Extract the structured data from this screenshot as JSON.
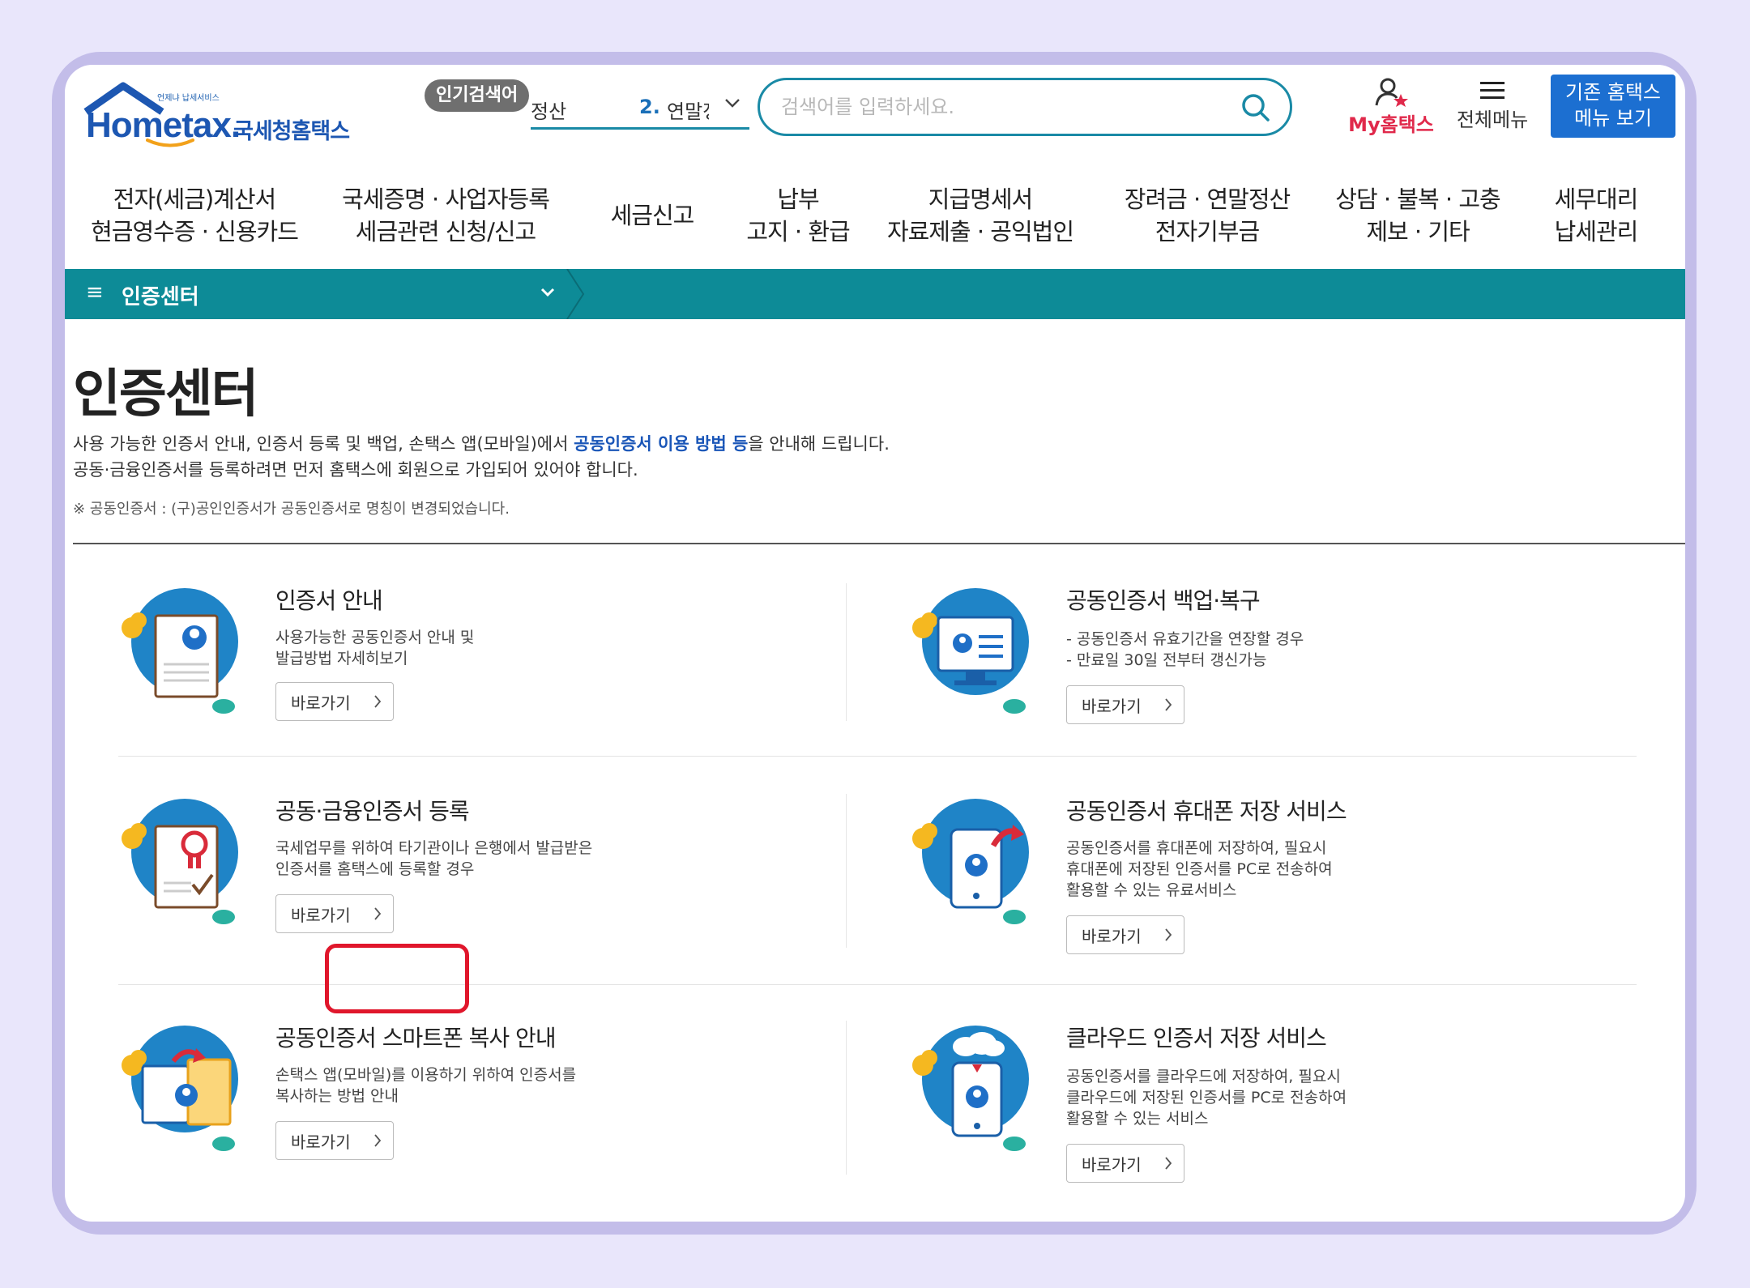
{
  "brand": {
    "logo_sub": "언제냐 납세서비스",
    "logo_name": "Hometax.",
    "logo_kr": "국세청홈택스"
  },
  "header": {
    "popular_label": "인기검색어",
    "popular_prev": "정산",
    "popular_rank": "2.",
    "popular_item": "연말정산",
    "search_placeholder": "검색어를 입력하세요.",
    "my_label": "My홈택스",
    "allmenu_label": "전체메뉴",
    "oldmenu_line1": "기존 홈택스",
    "oldmenu_line2": "메뉴 보기"
  },
  "gnb": [
    {
      "line1": "전자(세금)계산서",
      "line2": "현금영수증 · 신용카드"
    },
    {
      "line1": "국세증명 · 사업자등록",
      "line2": "세금관련 신청/신고"
    },
    {
      "line1": "세금신고",
      "line2": ""
    },
    {
      "line1": "납부",
      "line2": "고지 · 환급"
    },
    {
      "line1": "지급명세서",
      "line2": "자료제출 · 공익법인"
    },
    {
      "line1": "장려금 · 연말정산",
      "line2": "전자기부금"
    },
    {
      "line1": "상담 · 불복 · 고충",
      "line2": "제보 · 기타"
    },
    {
      "line1": "세무대리",
      "line2": "납세관리"
    }
  ],
  "lnb": {
    "title": "인증센터"
  },
  "page": {
    "title": "인증센터",
    "desc1_a": "사용 가능한 인증서 안내, 인증서 등록 및 백업, 손택스 앱(모바일)에서 ",
    "desc1_hl": "공동인증서 이용 방법 등",
    "desc1_b": "을 안내해 드립니다.",
    "desc2": "공동·금융인증서를 등록하려면 먼저 홈택스에 회원으로 가입되어 있어야 합니다.",
    "note": "※ 공동인증서 : (구)공인인증서가 공동인증서로 명칭이 변경되었습니다."
  },
  "go_label": "바로가기",
  "cards": [
    {
      "title": "인증서 안내",
      "lines": [
        "사용가능한 공동인증서 안내 및",
        "발급방법 자세히보기"
      ]
    },
    {
      "title": "공동인증서 백업·복구",
      "lines": [
        "- 공동인증서 유효기간을 연장할 경우",
        "- 만료일 30일 전부터 갱신가능"
      ]
    },
    {
      "title": "공동·금융인증서 등록",
      "lines": [
        "국세업무를 위하여 타기관이나 은행에서 발급받은",
        "인증서를 홈택스에 등록할 경우"
      ]
    },
    {
      "title": "공동인증서 휴대폰 저장 서비스",
      "lines": [
        "공동인증서를 휴대폰에 저장하여, 필요시",
        "휴대폰에 저장된 인증서를 PC로 전송하여",
        "활용할 수 있는 유료서비스"
      ]
    },
    {
      "title": "공동인증서 스마트폰 복사 안내",
      "lines": [
        "손택스 앱(모바일)를 이용하기 위하여 인증서를",
        "복사하는 방법 안내"
      ]
    },
    {
      "title": "클라우드 인증서 저장 서비스",
      "lines": [
        "공동인증서를 클라우드에 저장하여, 필요시",
        "클라우드에 저장된 인증서를 PC로 전송하여",
        "활용할 수 있는 서비스"
      ]
    }
  ],
  "colors": {
    "teal": "#0d8b97",
    "brand_blue": "#1d57b2",
    "highlight_red": "#e0162b",
    "my_red": "#e0294b"
  }
}
